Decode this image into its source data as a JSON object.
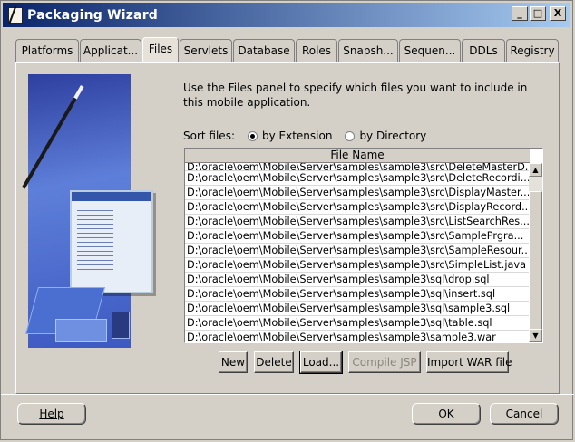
{
  "window": {
    "title": "Packaging Wizard"
  },
  "controls": {
    "minimize": "_",
    "maximize": "□",
    "close": "X"
  },
  "tabs": [
    {
      "label": "Platforms",
      "active": false
    },
    {
      "label": "Applicat...",
      "active": false
    },
    {
      "label": "Files",
      "active": true
    },
    {
      "label": "Servlets",
      "active": false
    },
    {
      "label": "Database",
      "active": false
    },
    {
      "label": "Roles",
      "active": false
    },
    {
      "label": "Snapsh...",
      "active": false
    },
    {
      "label": "Sequen...",
      "active": false
    },
    {
      "label": "DDLs",
      "active": false
    },
    {
      "label": "Registry",
      "active": false
    }
  ],
  "files_panel": {
    "description": "Use the Files panel to specify which files you want to include in this mobile application.",
    "sort_label": "Sort files:",
    "sort_options": [
      {
        "label": "by Extension",
        "selected": true
      },
      {
        "label": "by Directory",
        "selected": false
      }
    ],
    "table_header": "File Name",
    "files": [
      "D:\\oracle\\oem\\Mobile\\Server\\samples\\sample3\\src\\DeleteMasterD...",
      "D:\\oracle\\oem\\Mobile\\Server\\samples\\sample3\\src\\DeleteRecordi...",
      "D:\\oracle\\oem\\Mobile\\Server\\samples\\sample3\\src\\DisplayMaster...",
      "D:\\oracle\\oem\\Mobile\\Server\\samples\\sample3\\src\\DisplayRecord....",
      "D:\\oracle\\oem\\Mobile\\Server\\samples\\sample3\\src\\ListSearchRes...",
      "D:\\oracle\\oem\\Mobile\\Server\\samples\\sample3\\src\\SamplePrgra...",
      "D:\\oracle\\oem\\Mobile\\Server\\samples\\sample3\\src\\SampleResour...",
      "D:\\oracle\\oem\\Mobile\\Server\\samples\\sample3\\src\\SimpleList.java",
      "D:\\oracle\\oem\\Mobile\\Server\\samples\\sample3\\sql\\drop.sql",
      "D:\\oracle\\oem\\Mobile\\Server\\samples\\sample3\\sql\\insert.sql",
      "D:\\oracle\\oem\\Mobile\\Server\\samples\\sample3\\sql\\sample3.sql",
      "D:\\oracle\\oem\\Mobile\\Server\\samples\\sample3\\sql\\table.sql",
      "D:\\oracle\\oem\\Mobile\\Server\\samples\\sample3\\sample3.war"
    ],
    "buttons": {
      "new": "New",
      "delete": "Delete",
      "load": "Load...",
      "compile_jsp": "Compile JSP",
      "import_war": "Import WAR file"
    }
  },
  "footer": {
    "help": "Help",
    "ok": "OK",
    "cancel": "Cancel"
  }
}
